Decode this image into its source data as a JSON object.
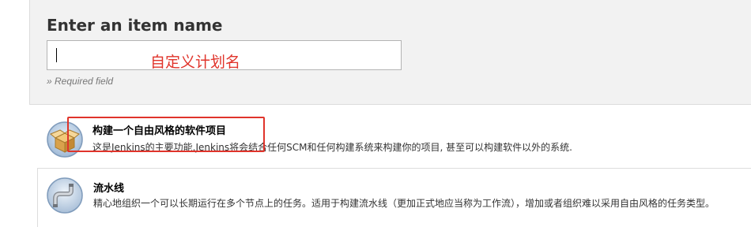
{
  "header": {
    "title": "Enter an item name",
    "input_value": "",
    "annotation": "自定义计划名",
    "required_note": "» Required field"
  },
  "items": [
    {
      "title": "构建一个自由风格的软件项目",
      "description": "这是Jenkins的主要功能.Jenkins将会结合任何SCM和任何构建系统来构建你的项目, 甚至可以构建软件以外的系统.",
      "icon": "freestyle-project-icon"
    },
    {
      "title": "流水线",
      "description": "精心地组织一个可以长期运行在多个节点上的任务。适用于构建流水线（更加正式地应当称为工作流），增加或者组织难以采用自由风格的任务类型。",
      "icon": "pipeline-icon"
    }
  ],
  "colors": {
    "annotation_red": "#e0342b",
    "header_bg": "#f2f2f2"
  }
}
